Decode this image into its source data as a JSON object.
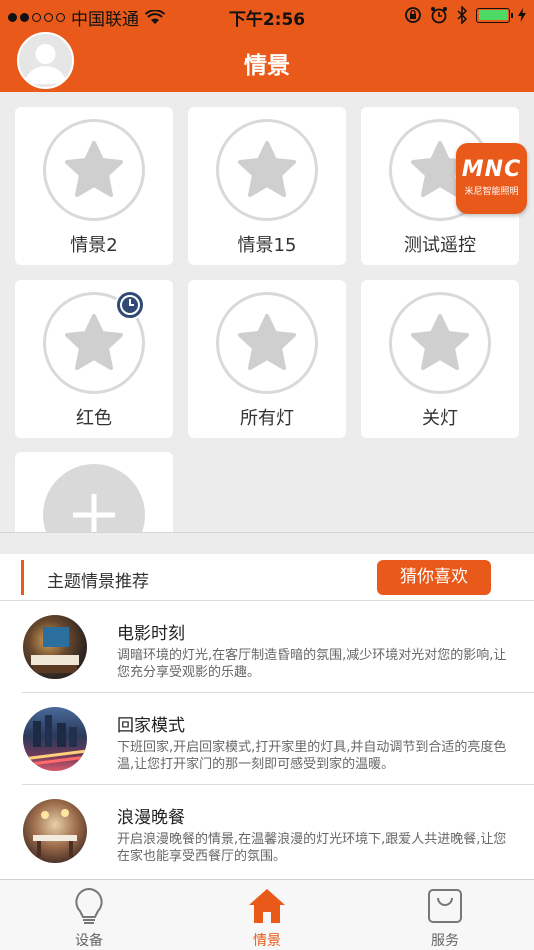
{
  "status_bar": {
    "carrier": "中国联通",
    "time": "下午2:56"
  },
  "nav": {
    "title": "情景"
  },
  "scenes": [
    {
      "label": "情景2",
      "timer": false
    },
    {
      "label": "情景15",
      "timer": false
    },
    {
      "label": "测试遥控",
      "timer": false
    },
    {
      "label": "红色",
      "timer": true
    },
    {
      "label": "所有灯",
      "timer": false
    },
    {
      "label": "关灯",
      "timer": false
    }
  ],
  "badge": {
    "brand": "MNC",
    "subtitle": "米尼智能照明"
  },
  "section": {
    "title": "主题情景推荐",
    "guess_label": "猜你喜欢"
  },
  "recommendations": [
    {
      "title": "电影时刻",
      "desc": "调暗环境的灯光,在客厅制造昏暗的氛围,减少环境对光对您的影响,让您充分享受观影的乐趣。"
    },
    {
      "title": "回家模式",
      "desc": "下班回家,开启回家模式,打开家里的灯具,并自动调节到合适的亮度色温,让您打开家门的那一刻即可感受到家的温暖。"
    },
    {
      "title": "浪漫晚餐",
      "desc": "开启浪漫晚餐的情景,在温馨浪漫的灯光环境下,跟爱人共进晚餐,让您在家也能享受西餐厅的氛围。"
    }
  ],
  "tabs": [
    {
      "label": "设备",
      "icon": "bulb-icon",
      "active": false
    },
    {
      "label": "情景",
      "icon": "home-icon",
      "active": true
    },
    {
      "label": "服务",
      "icon": "bag-icon",
      "active": false
    }
  ],
  "colors": {
    "accent": "#e8591a",
    "clock": "#2f4a74"
  }
}
